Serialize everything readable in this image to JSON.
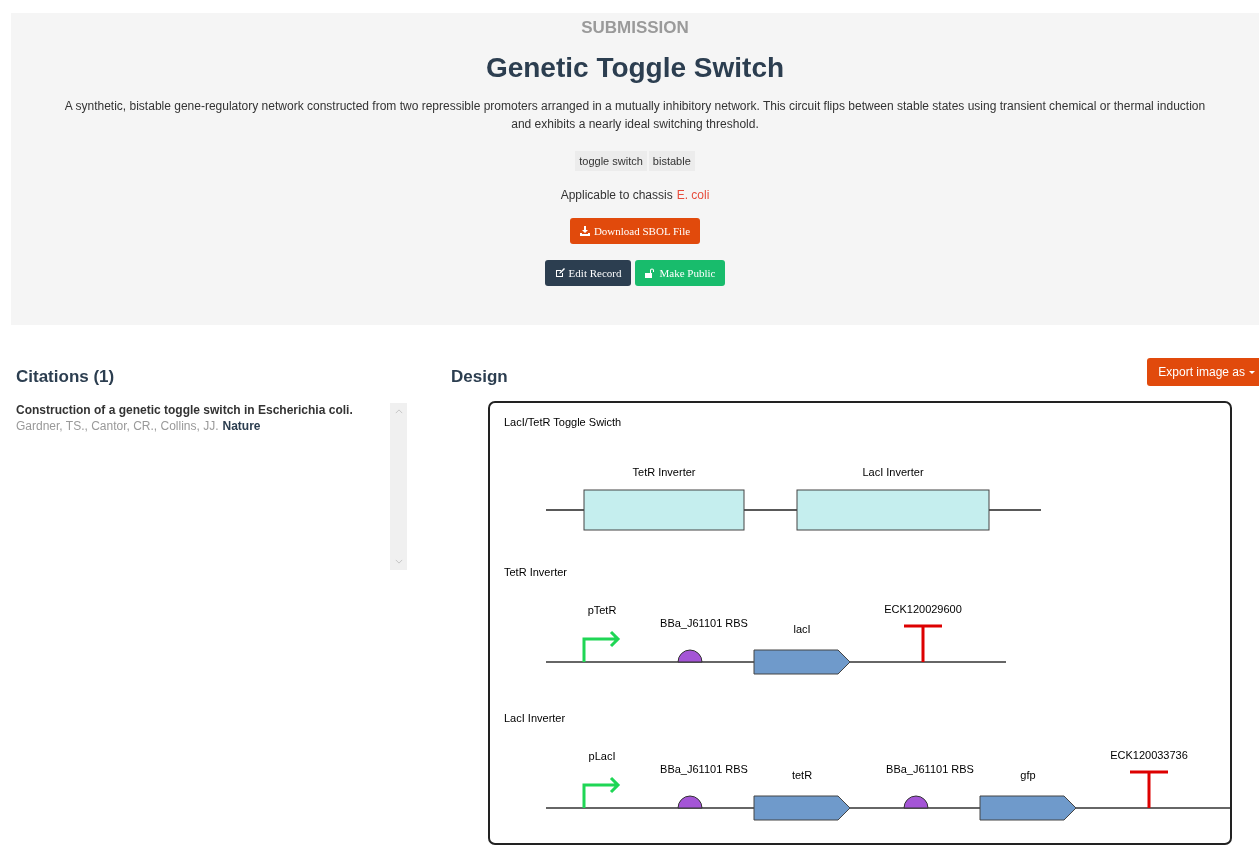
{
  "header": {
    "eyebrow": "SUBMISSION",
    "title": "Genetic Toggle Switch",
    "description": "A synthetic, bistable gene-regulatory network constructed from two repressible promoters arranged in a mutually inhibitory network. This circuit flips between stable states using transient chemical or thermal induction and exhibits a nearly ideal switching threshold.",
    "tags": [
      "toggle switch",
      "bistable"
    ],
    "chassis_label": "Applicable to chassis",
    "chassis_link": "E. coli",
    "download_button": "Download SBOL File",
    "edit_button": "Edit Record",
    "public_button": "Make Public"
  },
  "citations": {
    "heading": "Citations (1)",
    "items": [
      {
        "title": "Construction of a genetic toggle switch in Escherichia coli.",
        "authors": "Gardner, TS., Cantor, CR., Collins, JJ.",
        "journal": "Nature"
      }
    ]
  },
  "design": {
    "heading": "Design",
    "export_button": "Export image as",
    "diagram": {
      "title": "LacI/TetR Toggle Swicth",
      "modules": [
        {
          "label": "TetR Inverter"
        },
        {
          "label": "LacI Inverter"
        }
      ],
      "sections": [
        {
          "title": "TetR Inverter",
          "parts": [
            {
              "kind": "promoter",
              "label": "pTetR"
            },
            {
              "kind": "rbs",
              "label": "BBa_J61101 RBS"
            },
            {
              "kind": "cds",
              "label": "lacI"
            },
            {
              "kind": "terminator",
              "label": "ECK120029600"
            }
          ]
        },
        {
          "title": "LacI Inverter",
          "parts": [
            {
              "kind": "promoter",
              "label": "pLacI"
            },
            {
              "kind": "rbs",
              "label": "BBa_J61101 RBS"
            },
            {
              "kind": "cds",
              "label": "tetR"
            },
            {
              "kind": "rbs",
              "label": "BBa_J61101 RBS"
            },
            {
              "kind": "cds",
              "label": "gfp"
            },
            {
              "kind": "terminator",
              "label": "ECK120033736"
            }
          ]
        }
      ]
    }
  }
}
